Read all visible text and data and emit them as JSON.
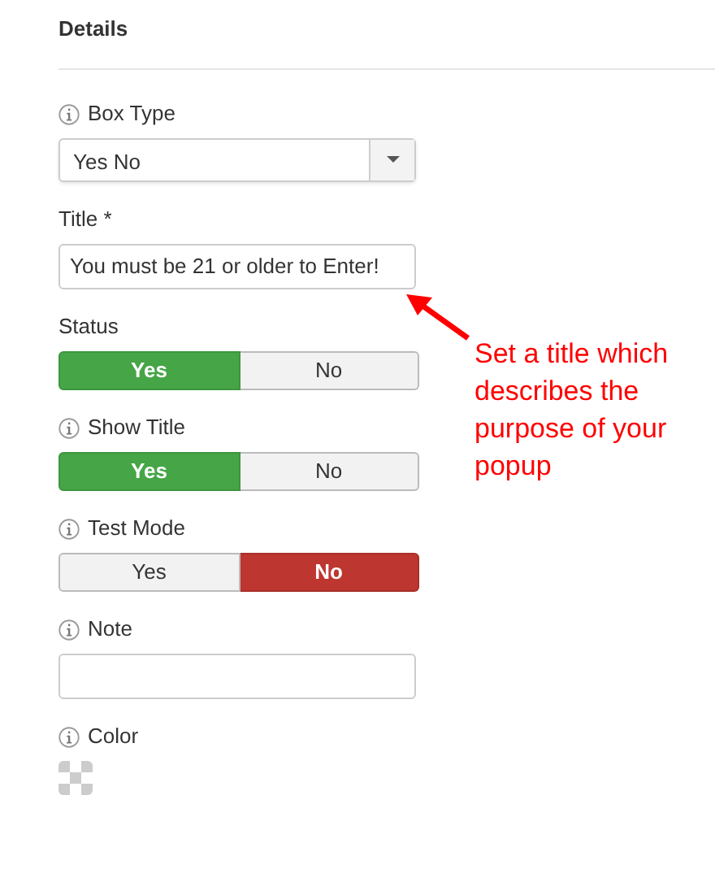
{
  "heading": "Details",
  "fields": [
    {
      "kind": "select",
      "label": "Box Type",
      "info": true,
      "value": "Yes No"
    },
    {
      "kind": "text",
      "label": "Title *",
      "info": false,
      "value": "You must be 21 or older to Enter!"
    },
    {
      "kind": "toggle",
      "label": "Status",
      "info": false,
      "options": [
        {
          "label": "Yes",
          "selected": true
        },
        {
          "label": "No",
          "selected": false
        }
      ]
    },
    {
      "kind": "toggle",
      "label": "Show Title",
      "info": true,
      "options": [
        {
          "label": "Yes",
          "selected": true
        },
        {
          "label": "No",
          "selected": false
        }
      ]
    },
    {
      "kind": "toggle",
      "label": "Test Mode",
      "info": true,
      "options": [
        {
          "label": "Yes",
          "selected": false
        },
        {
          "label": "No",
          "selected": true
        }
      ]
    },
    {
      "kind": "text",
      "label": "Note",
      "info": true
    },
    {
      "kind": "color",
      "label": "Color",
      "info": true
    }
  ],
  "annotation": {
    "text": "Set a title which describes the purpose of your popup"
  }
}
